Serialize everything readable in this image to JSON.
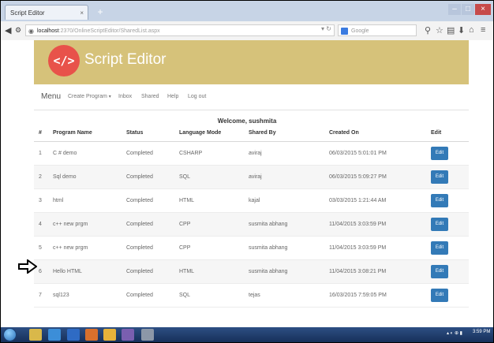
{
  "browser": {
    "tab_title": "Script Editor",
    "new_tab": "+",
    "url_host": "localhost",
    "url_path": ":2370/OnlineScriptEditor/SharedList.aspx",
    "search_placeholder": "Google"
  },
  "app": {
    "logo_text": "</>",
    "title": "Script Editor"
  },
  "menu": {
    "brand": "Menu",
    "items": [
      "Create Program",
      "Inbox",
      "Shared",
      "Help",
      "Log out"
    ]
  },
  "welcome": "Welcome,  sushmita",
  "table": {
    "headers": [
      "#",
      "Program Name",
      "Status",
      "Language Mode",
      "Shared By",
      "Created On",
      "Edit"
    ],
    "rows": [
      {
        "num": "1",
        "name": "C # demo",
        "status": "Completed",
        "mode": "CSHARP",
        "shared_by": "aviraj",
        "created": "06/03/2015 5:01:01 PM",
        "edit": "Edit"
      },
      {
        "num": "2",
        "name": "Sql demo",
        "status": "Completed",
        "mode": "SQL",
        "shared_by": "aviraj",
        "created": "06/03/2015 5:09:27 PM",
        "edit": "Edit"
      },
      {
        "num": "3",
        "name": "html",
        "status": "Completed",
        "mode": "HTML",
        "shared_by": "kajal",
        "created": "03/03/2015 1:21:44 AM",
        "edit": "Edit"
      },
      {
        "num": "4",
        "name": "c++ new prgm",
        "status": "Completed",
        "mode": "CPP",
        "shared_by": "susmita abhang",
        "created": "11/04/2015 3:03:59 PM",
        "edit": "Edit"
      },
      {
        "num": "5",
        "name": "c++ new prgm",
        "status": "Completed",
        "mode": "CPP",
        "shared_by": "susmita abhang",
        "created": "11/04/2015 3:03:59 PM",
        "edit": "Edit"
      },
      {
        "num": "6",
        "name": "Hello HTML",
        "status": "Completed",
        "mode": "HTML",
        "shared_by": "susmita abhang",
        "created": "11/04/2015 3:08:21 PM",
        "edit": "Edit"
      },
      {
        "num": "7",
        "name": "sql123",
        "status": "Completed",
        "mode": "SQL",
        "shared_by": "tejas",
        "created": "16/03/2015 7:59:05 PM",
        "edit": "Edit"
      }
    ]
  },
  "taskbar": {
    "clock": "3:59 PM"
  },
  "colors": {
    "header_band": "#d6c27a",
    "logo_circle": "#e8524a",
    "edit_button": "#337ab7"
  }
}
